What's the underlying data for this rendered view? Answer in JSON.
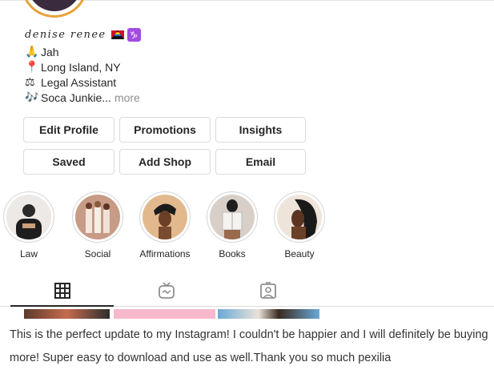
{
  "profile": {
    "handle": "denise renee",
    "bio": [
      {
        "icon": "praying-hands-icon",
        "glyph": "🙏",
        "text": "Jah"
      },
      {
        "icon": "round-pushpin-icon",
        "glyph": "📍",
        "text": "Long Island, NY"
      },
      {
        "icon": "scales-icon",
        "glyph": "⚖",
        "text": "Legal Assistant"
      },
      {
        "icon": "musical-notes-icon",
        "glyph": "🎶",
        "text": "Soca Junkie..."
      }
    ],
    "more_label": "more",
    "capricorn_glyph": "♑"
  },
  "buttons": {
    "edit_profile": "Edit Profile",
    "promotions": "Promotions",
    "insights": "Insights",
    "saved": "Saved",
    "add_shop": "Add Shop",
    "email": "Email"
  },
  "highlights": [
    {
      "label": "Law"
    },
    {
      "label": "Social"
    },
    {
      "label": "Affirmations"
    },
    {
      "label": "Books"
    },
    {
      "label": "Beauty"
    }
  ],
  "tabs": [
    {
      "name": "grid-icon",
      "active": true
    },
    {
      "name": "igtv-icon",
      "active": false
    },
    {
      "name": "tagged-icon",
      "active": false
    }
  ],
  "review": {
    "text": "This is the perfect update to my Instagram! I couldn't be happier and I will definitely be buying more! Super easy to download and use as well.Thank you so much pexilia"
  },
  "colors": {
    "avatar_ring": "#e8a23a",
    "capricorn_bg": "#a14ce1",
    "border": "#dbdbdb",
    "muted": "#8e8e8e"
  }
}
